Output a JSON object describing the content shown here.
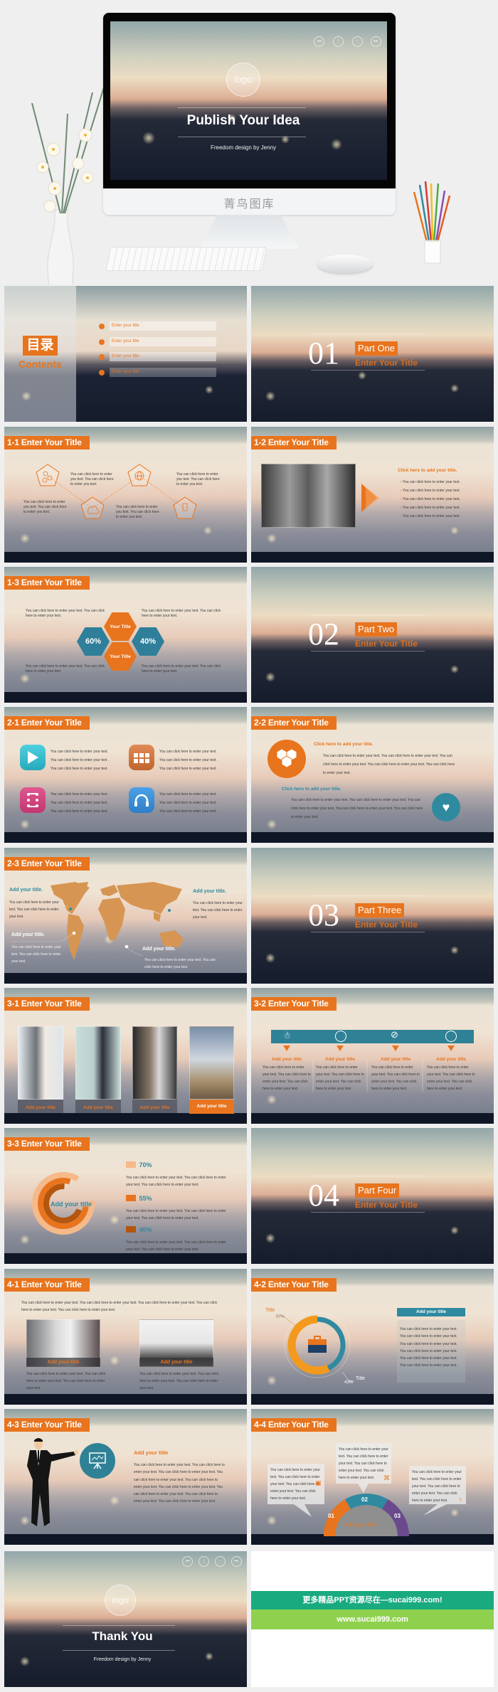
{
  "hero": {
    "logo": "logo",
    "title": "Publish Your Idea",
    "subtitle": "Freedom design by Jenny",
    "watermark": "菁鸟图库",
    "controls": [
      "rewind-icon",
      "info-icon",
      "stop-icon",
      "fast-forward-icon"
    ],
    "control_glyphs": [
      "◂◂",
      "i",
      "▫",
      "▸▸"
    ]
  },
  "contents": {
    "heading_cn": "目录",
    "heading_en": "Contents",
    "items": [
      "Enter your title",
      "Enter your title",
      "Enter your title",
      "Enter your title"
    ]
  },
  "sections": [
    {
      "number": "01",
      "part": "Part One",
      "subtitle": "Enter Your Title"
    },
    {
      "number": "02",
      "part": "Part Two",
      "subtitle": "Enter Your Title"
    },
    {
      "number": "03",
      "part": "Part Three",
      "subtitle": "Enter Your Title"
    },
    {
      "number": "04",
      "part": "Part Four",
      "subtitle": "Enter Your Title"
    }
  ],
  "s1_1": {
    "title": "1-1 Enter  Your  Title",
    "texts": [
      "You can click here to enter you text. You can click here to enter you text.",
      "You can click here to enter you text. You can click here to enter you text.",
      "You can click here to enter you text. You can click here to enter you text.",
      "You can click here to enter you text. You can click here to enter you text."
    ]
  },
  "s1_2": {
    "title": "1-2 Enter  Your  Title",
    "heading": "Click here to add your title.",
    "bullets": [
      "You can click here to enter your text.",
      "You can click here to enter your text.",
      "You can click here to enter your text.",
      "You can click here to enter your text.",
      "You can click here to enter your text ."
    ]
  },
  "s1_3": {
    "title": "1-3 Enter  Your  Title",
    "hex_top": "Your Title",
    "hex_bottom": "Your Title",
    "left_pct": "60%",
    "right_pct": "40%",
    "texts": [
      "You can click here to enter your text.  You can click here to enter your text.",
      "You can click here to enter your text.  You can click here to enter your text.",
      "You can click here to enter your text.  You can click here to enter your text.",
      "You can click here to enter your text.  You can click here to enter your text."
    ]
  },
  "s2_1": {
    "title": "2-1 Enter  Your  Title",
    "groups": [
      {
        "icon": "play-icon",
        "lines": [
          "You can click here to enter your text.",
          "You can click here to enter your text .",
          "You can click here to enter your  text."
        ]
      },
      {
        "icon": "grid-icon",
        "lines": [
          "You can click here to enter your text.",
          "You can click here to enter your text .",
          "You can click here to enter your  text."
        ]
      },
      {
        "icon": "film-icon",
        "lines": [
          "You can click here to enter your text.",
          "You can click here to enter your text .",
          "You can click here to enter your  text."
        ]
      },
      {
        "icon": "headphones-icon",
        "lines": [
          "You can click here to enter your text.",
          "You can click here to enter your text .",
          "You can click here to enter your  text."
        ]
      }
    ]
  },
  "s2_2": {
    "title": "2-2 Enter  Your  Title",
    "heading1": "Click here to add your title.",
    "text1": "You can click here to enter your text. You can click here to enter your text. You can click here to enter your text. You can click here to enter your text. You can click here to enter your text.",
    "heading2": "Click here to add your title.",
    "text2": "You can click here to enter your text. You can click here to enter your text. You can click here to enter your text. You can click here to enter your text. You can click here to enter your text."
  },
  "s2_3": {
    "title": "2-3 Enter  Your  Title",
    "callouts": [
      {
        "title": "Add your title.",
        "text": "You can click here to enter your text. You can click here to enter your text."
      },
      {
        "title": "Add your title.",
        "text": "You can click here to enter your text. You can click here to enter your text."
      },
      {
        "title": "Add your title.",
        "text": "You can click here to enter your text. You can click here to enter your text."
      },
      {
        "title": "Add your title.",
        "text": "You can click here to enter your text. You can click here to enter your text."
      }
    ]
  },
  "s3_1": {
    "title": "3-1 Enter  Your  Title",
    "captions": [
      "Add your title",
      "Add your title",
      "Add your title",
      "Add your title"
    ]
  },
  "s3_2": {
    "title": "3-2 Enter  Your  Title",
    "columns": [
      {
        "icon": "person-icon",
        "title": "Add your title",
        "text": "You can click here to enter your text. You can click here to enter your text. You can click here to enter your text."
      },
      {
        "icon": "globe-icon",
        "title": "Add your title",
        "text": "You can click here to enter your text. You can click here to enter your text. You can click here to enter your text."
      },
      {
        "icon": "pin-icon",
        "title": "Add your title",
        "text": "You can click here to enter your text. You can click here to enter your text. You can click here to enter your text."
      },
      {
        "icon": "gauge-icon",
        "title": "Add your title",
        "text": "You can click here to enter your text. You can click here to enter your text. You can click here to enter your text."
      }
    ]
  },
  "s3_3": {
    "title": "3-3 Enter  Your  Title",
    "ring_label": "Add your title",
    "items": [
      {
        "pct": "70%",
        "value": 70,
        "color": "#f6b98a",
        "text": "You can click here to enter your text.  You can click here to enter your text. You can click here to enter your text."
      },
      {
        "pct": "55%",
        "value": 55,
        "color": "#e8741e",
        "text": "You can click here to enter your text.  You can click here to enter your text. You can click here to enter your text."
      },
      {
        "pct": "40%",
        "value": 40,
        "color": "#b3560f",
        "text": "You can click here to enter your text.  You can click here to enter your text. You can click here to enter your text."
      }
    ]
  },
  "s4_1": {
    "title": "4-1 Enter  Your  Title",
    "intro": "You can click here to enter your text.  You can click here to enter your text. You can click here to enter your text. You can click here to enter your text. You can click here to enter your text.",
    "cards": [
      {
        "caption": "Add your title",
        "text": "You can click here to enter your text.  You can click here to enter your text. You can click here to enter your text."
      },
      {
        "caption": "Add your title",
        "text": "You can click here to enter your text.  You can click here to enter your text. You can click here to enter your text."
      }
    ]
  },
  "s4_2": {
    "title": "4-2 Enter  Your  Title",
    "label_a": "Title",
    "pct_a": "57%",
    "value_a": 57,
    "color_a": "#f39a1e",
    "label_b": "Title",
    "pct_b": "43%",
    "value_b": 43,
    "color_b": "#2f8aa0",
    "panel_title": "Add your title",
    "lines": [
      "You can click here to enter your text.",
      "You can click here to enter your text.",
      "You can click here to enter your text.",
      "You can click here to enter your text.",
      "You can click here to enter your text.",
      "You can click here to enter your text."
    ]
  },
  "s4_3": {
    "title": "4-3 Enter  Your  Title",
    "heading": "Add your title",
    "text": "You can click here to enter your text.  You can click here to enter your text.  You can click here to enter your text. You can click here to enter your text. You can click here to enter your text. You can click here to enter your text. You can click here to enter your text. You can click here to enter your text. You can click here to enter your text."
  },
  "s4_4": {
    "title": "4-4 Enter  Your  Title",
    "center_label": "Add your title",
    "segments": [
      "01",
      "02",
      "03"
    ],
    "segment_colors": [
      "#e8741e",
      "#2f8aa0",
      "#6a4a8c"
    ],
    "boxes": [
      "You can click here to enter your text. You can click here to enter your text. You can click here to enter your text. You can click here to enter your text.",
      "You can click here to enter your text. You can click here to enter your text. You can click here to enter your text. You can click here to enter your text.",
      "You can click here to enter your text. You can click here to enter your text. You can click here to enter your text. You can click here to enter your text."
    ]
  },
  "thanks": {
    "logo": "logo",
    "title": "Thank You",
    "subtitle": "Freedom design by Jenny",
    "control_glyphs": [
      "◂◂",
      "i",
      "▫",
      "▸▸"
    ]
  },
  "ad": {
    "line1": "更多精品PPT资源尽在—sucai999.com!",
    "line2": "www.sucai999.com",
    "color1": "#1aaa7f",
    "color2": "#8fd14f"
  },
  "colors": {
    "accent": "#e8741e",
    "teal": "#2f8aa0",
    "dark": "#0f1727"
  }
}
